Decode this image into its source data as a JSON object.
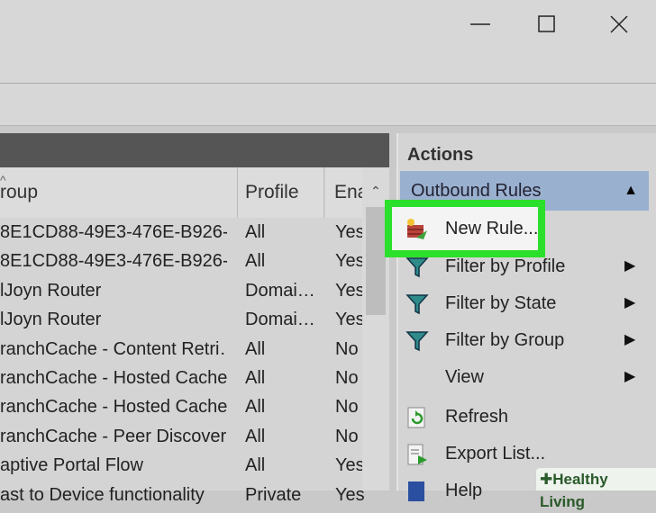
{
  "window": {
    "icons": {
      "minimize": "minimize-icon",
      "maximize": "maximize-icon",
      "close": "close-icon"
    }
  },
  "table": {
    "columns": {
      "group": "roup",
      "profile": "Profile",
      "enabled": "Ena"
    },
    "rows": [
      {
        "group": "8E1CD88-49E3-476E-B926-…",
        "profile": "All",
        "enabled": "Yes"
      },
      {
        "group": "8E1CD88-49E3-476E-B926-…",
        "profile": "All",
        "enabled": "Yes"
      },
      {
        "group": "lJoyn Router",
        "profile": "Domai…",
        "enabled": "Yes"
      },
      {
        "group": "lJoyn Router",
        "profile": "Domai…",
        "enabled": "Yes"
      },
      {
        "group": "ranchCache - Content Retri…",
        "profile": "All",
        "enabled": "No"
      },
      {
        "group": "ranchCache - Hosted Cache…",
        "profile": "All",
        "enabled": "No"
      },
      {
        "group": "ranchCache - Hosted Cache…",
        "profile": "All",
        "enabled": "No"
      },
      {
        "group": "ranchCache - Peer Discover…",
        "profile": "All",
        "enabled": "No"
      },
      {
        "group": "aptive Portal Flow",
        "profile": "All",
        "enabled": "Yes"
      },
      {
        "group": "ast to Device functionality",
        "profile": "Private",
        "enabled": "Yes"
      }
    ]
  },
  "actions": {
    "title": "Actions",
    "section": "Outbound Rules",
    "items": [
      {
        "label": "New Rule...",
        "icon": "new-rule-icon"
      },
      {
        "label": "Filter by Profile",
        "icon": "filter-icon"
      },
      {
        "label": "Filter by State",
        "icon": "filter-icon"
      },
      {
        "label": "Filter by Group",
        "icon": "filter-icon"
      },
      {
        "label": "View",
        "icon": ""
      },
      {
        "label": "Refresh",
        "icon": "refresh-icon"
      },
      {
        "label": "Export List...",
        "icon": "export-icon"
      },
      {
        "label": "Help",
        "icon": "help-icon"
      }
    ]
  },
  "watermark": {
    "text": "Healthy Living"
  },
  "colors": {
    "highlight": "#2be02b",
    "section_bar": "#9ab0cf"
  }
}
